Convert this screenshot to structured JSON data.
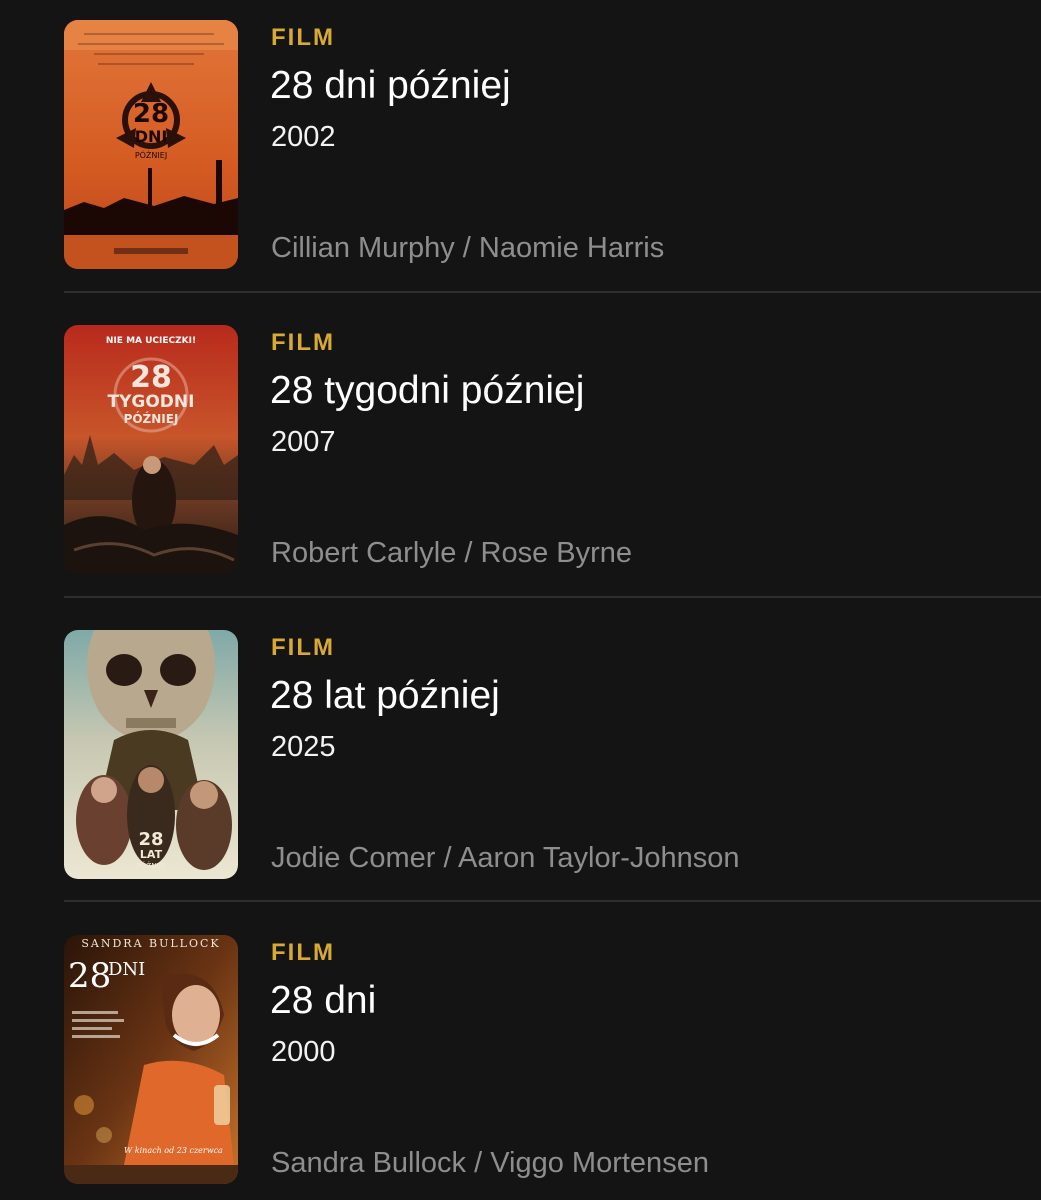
{
  "colors": {
    "background": "#141414",
    "category": "#d9aa33",
    "title": "#ffffff",
    "cast": "#8e8e8e",
    "divider": "#2e2e2e"
  },
  "results": [
    {
      "category": "FILM",
      "title": "28 dni później",
      "year": "2002",
      "cast": "Cillian Murphy / Naomie Harris",
      "poster_text": [
        "28",
        "DNI",
        "PÓŹNIEJ"
      ]
    },
    {
      "category": "FILM",
      "title": "28 tygodni później",
      "year": "2007",
      "cast": "Robert Carlyle / Rose Byrne",
      "poster_text": [
        "NIE MA UCIECZKI!",
        "28",
        "TYGODNI",
        "PÓŹNIEJ"
      ]
    },
    {
      "category": "FILM",
      "title": "28 lat później",
      "year": "2025",
      "cast": "Jodie Comer / Aaron Taylor-Johnson",
      "poster_text": [
        "28",
        "LAT",
        "PÓŹNIEJ"
      ]
    },
    {
      "category": "FILM",
      "title": "28 dni",
      "year": "2000",
      "cast": "Sandra Bullock / Viggo Mortensen",
      "poster_text": [
        "SANDRA BULLOCK",
        "28",
        "DNI",
        "W kinach od 23 czerwca"
      ]
    }
  ]
}
